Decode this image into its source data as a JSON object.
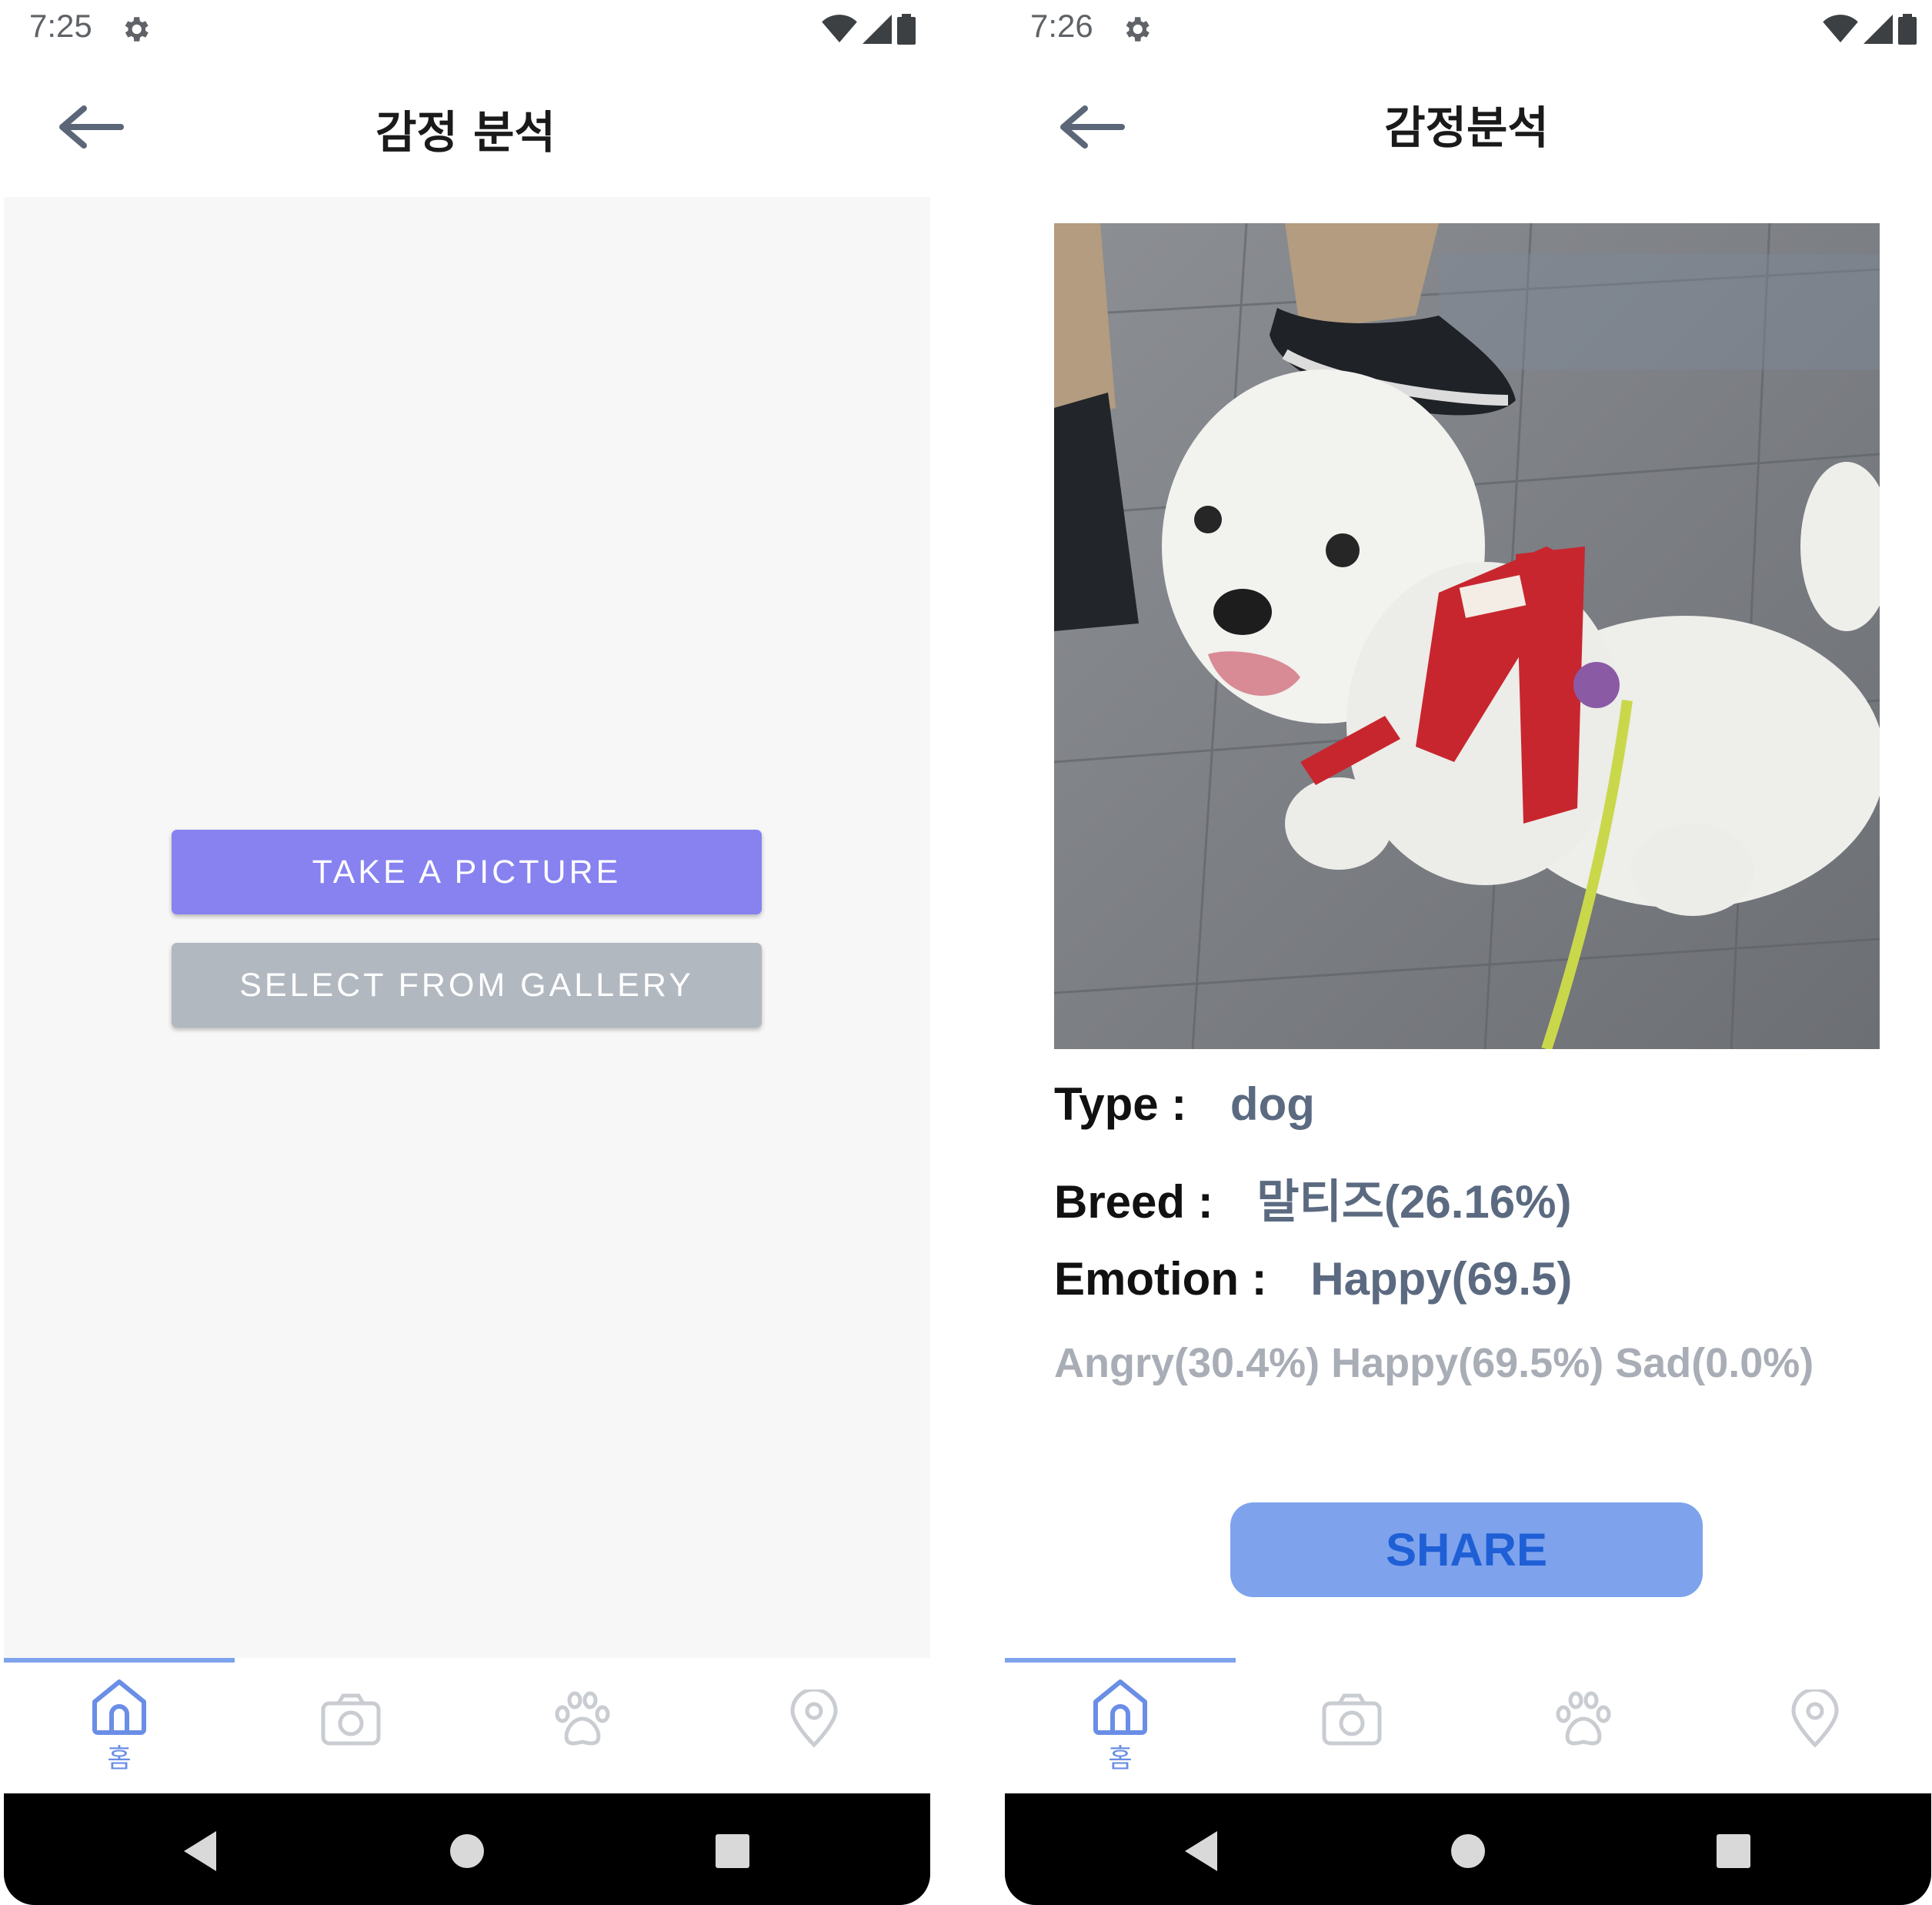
{
  "screens": {
    "left": {
      "status_time": "7:25",
      "title": "감정 분석",
      "take_picture_label": "TAKE A PICTURE",
      "select_gallery_label": "SELECT FROM GALLERY",
      "home_tab_label": "홈"
    },
    "right": {
      "status_time": "7:26",
      "title": "감정분석",
      "type_label": "Type :",
      "type_value": "dog",
      "breed_label": "Breed :",
      "breed_value": "말티즈(26.16%)",
      "emotion_label": "Emotion :",
      "emotion_value": "Happy(69.5)",
      "probabilities": "Angry(30.4%) Happy(69.5%) Sad(0.0%)",
      "share_label": "SHARE",
      "home_tab_label": "홈"
    }
  },
  "icons": [
    "gear-icon",
    "wifi-icon",
    "signal-icon",
    "battery-icon",
    "back-arrow-icon",
    "home-icon",
    "camera-icon",
    "paw-icon",
    "location-pin-icon",
    "nav-back-icon",
    "nav-home-icon",
    "nav-recents-icon"
  ],
  "colors": {
    "primary_button": "#8782f0",
    "secondary_button": "#b2b8c0",
    "share_button": "#7ea3ec",
    "share_text": "#1f5fd6",
    "tab_active": "#6a8ee6",
    "tab_inactive": "#c9ccd1"
  }
}
